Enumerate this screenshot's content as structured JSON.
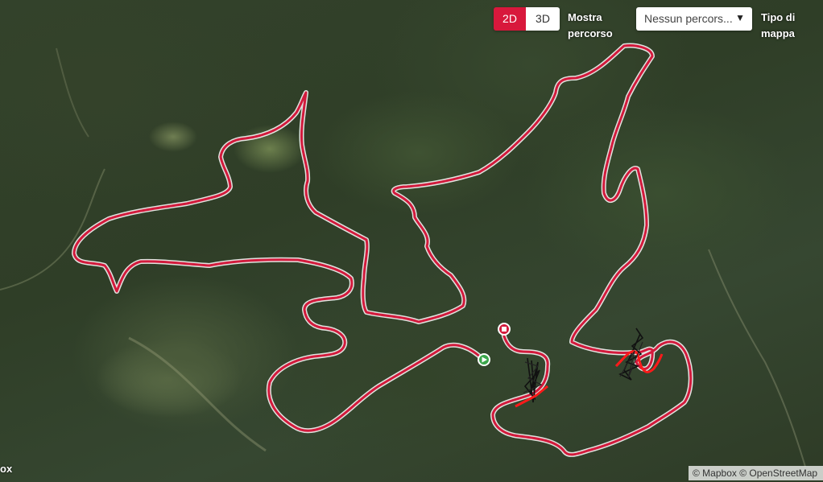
{
  "map": {
    "view_modes": [
      "2D",
      "3D"
    ],
    "active_view_mode": "2D",
    "show_route_label": [
      "Mostra",
      "percorso"
    ],
    "route_select_value": "Nessun percors...",
    "map_type_label": [
      "Tipo di",
      "mappa"
    ],
    "attribution": "© Mapbox © OpenStreetMap",
    "logo_fragment": "ox",
    "colors": {
      "route": "#d21a3c",
      "active_toggle": "#d8183c",
      "start_marker": "#3aa54a",
      "end_marker": "#d21a3c",
      "overlap_scribble": "#111111"
    },
    "markers": [
      {
        "name": "start",
        "icon": "play-icon"
      },
      {
        "name": "end",
        "icon": "stop-icon"
      }
    ]
  }
}
